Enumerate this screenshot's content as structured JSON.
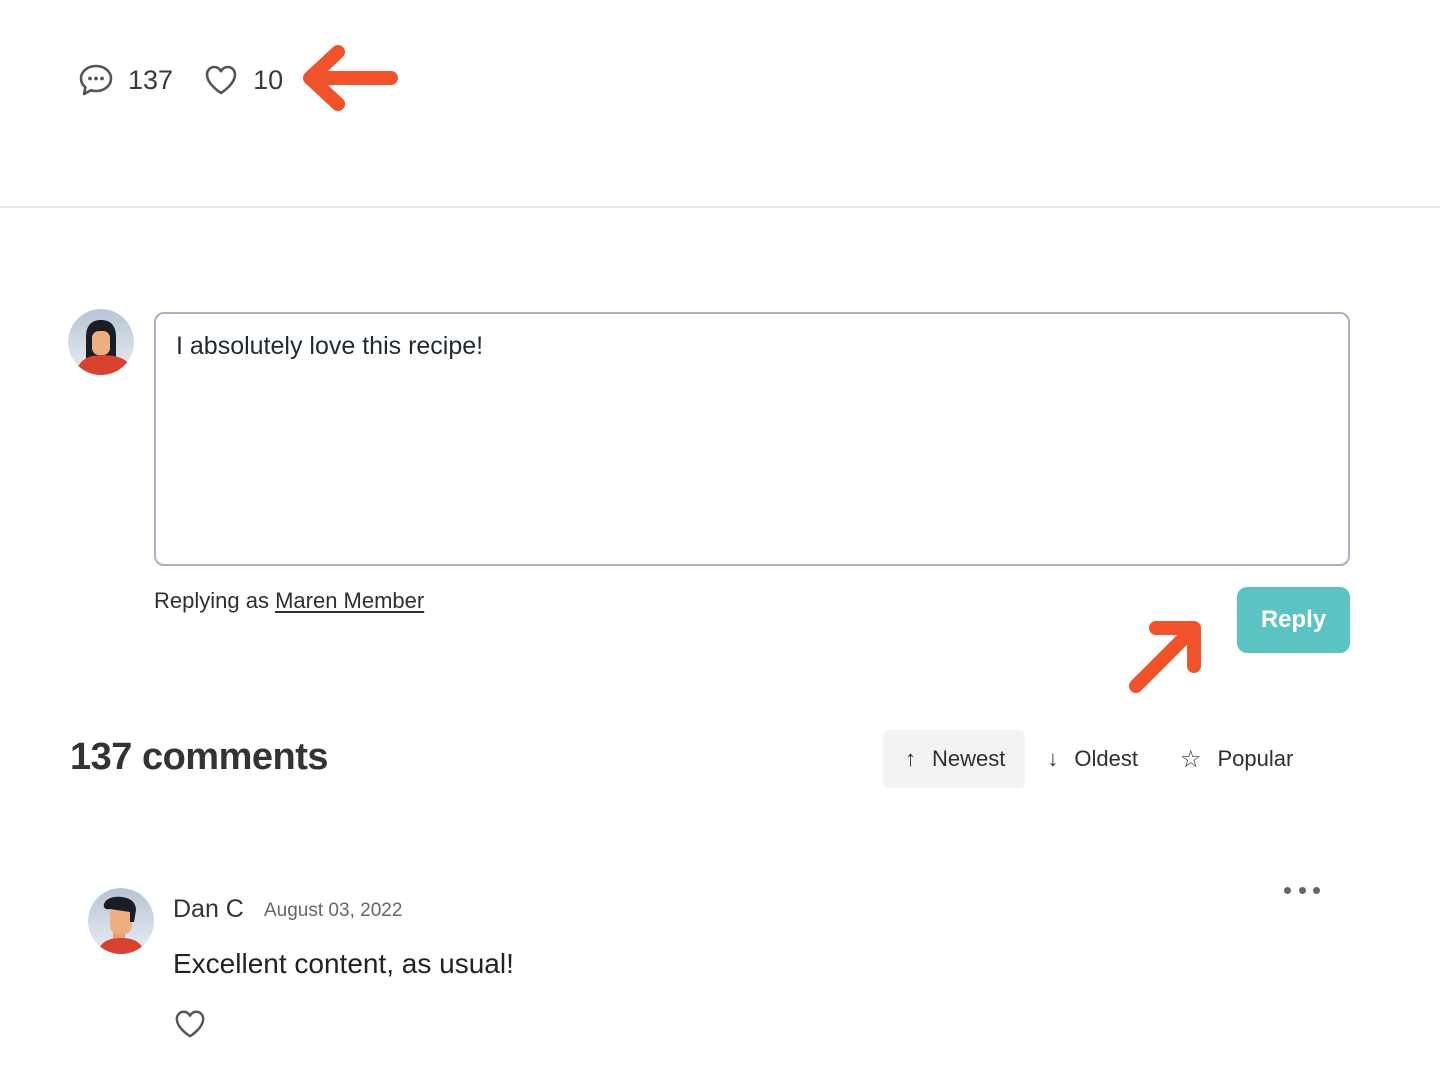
{
  "stats": {
    "comments_icon": "chat-bubble-icon",
    "comments_count": "137",
    "likes_icon": "heart-outline-icon",
    "likes_count": "10"
  },
  "annotations": {
    "color": "#f0522b",
    "arrows": [
      "arrow-pointing-left-at-likes",
      "arrow-pointing-up-right-at-reply-button"
    ]
  },
  "composer": {
    "avatar": "female-user-avatar",
    "value": "I absolutely love this recipe!",
    "replying_prefix": "Replying as",
    "replying_user": "Maren Member",
    "reply_label": "Reply",
    "reply_color": "#5bc3c2"
  },
  "comments_section": {
    "title": "137 comments",
    "sort_options": [
      {
        "label": "Newest",
        "icon": "arrow-up-icon",
        "glyph": "↑",
        "active": true
      },
      {
        "label": "Oldest",
        "icon": "arrow-down-icon",
        "glyph": "↓",
        "active": false
      },
      {
        "label": "Popular",
        "icon": "star-icon",
        "glyph": "☆",
        "active": false
      }
    ]
  },
  "comments": [
    {
      "author": "Dan C",
      "date": "August 03, 2022",
      "text": "Excellent content, as usual!",
      "avatar": "male-user-avatar",
      "like_icon": "heart-outline-icon",
      "more_icon": "more-options-icon"
    }
  ]
}
